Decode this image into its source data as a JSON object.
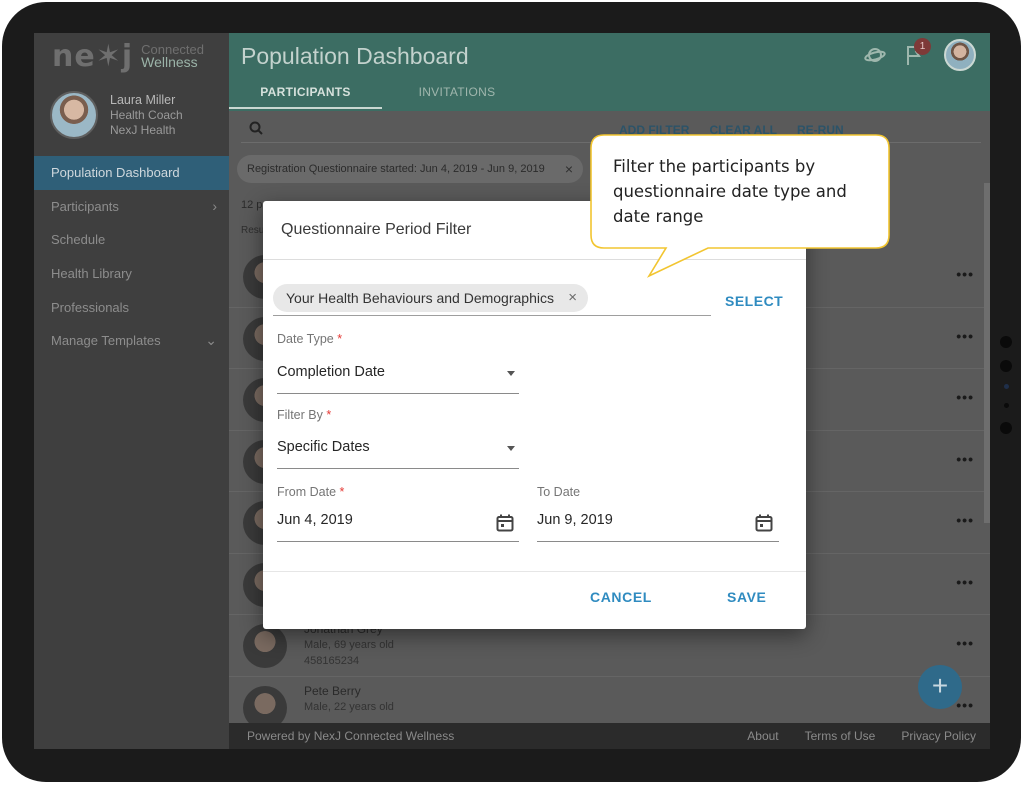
{
  "brand": {
    "mark": "ne✶j",
    "line1": "Connected",
    "line2": "Wellness"
  },
  "user": {
    "name": "Laura Miller",
    "role": "Health Coach",
    "org": "NexJ Health"
  },
  "sidebar": {
    "items": [
      {
        "label": "Population Dashboard",
        "active": true
      },
      {
        "label": "Participants",
        "chevron": "›"
      },
      {
        "label": "Schedule"
      },
      {
        "label": "Health Library"
      },
      {
        "label": "Professionals"
      },
      {
        "label": "Manage Templates",
        "chevron": "⌄"
      }
    ]
  },
  "header": {
    "title": "Population Dashboard",
    "tabs": [
      "PARTICIPANTS",
      "INVITATIONS"
    ],
    "notification_count": "1",
    "icons": [
      "saturn-icon",
      "flag-icon",
      "profile-avatar"
    ]
  },
  "content": {
    "actions": [
      "ADD FILTER",
      "CLEAR ALL",
      "RE-RUN"
    ],
    "filter_chip": "Registration Questionnaire started: Jun 4, 2019 -  Jun 9, 2019",
    "count": "12 p",
    "results_label": "Resu",
    "participants": [
      {
        "name": "",
        "detail": "",
        "id": ""
      },
      {
        "name": "",
        "detail": "",
        "id": ""
      },
      {
        "name": "",
        "detail": "",
        "id": ""
      },
      {
        "name": "",
        "detail": "",
        "id": ""
      },
      {
        "name": "",
        "detail": "",
        "id": ""
      },
      {
        "name": "",
        "detail": "",
        "id": ""
      },
      {
        "name": "Jonathan Grey",
        "detail": "Male, 69 years old",
        "id": "458165234"
      },
      {
        "name": "Pete Berry",
        "detail": "Male, 22 years old",
        "id": ""
      }
    ],
    "more_glyph": "•••"
  },
  "footer": {
    "powered_by": "Powered by NexJ Connected Wellness",
    "links": [
      "About",
      "Terms of Use",
      "Privacy Policy"
    ]
  },
  "fab": {
    "glyph": "+"
  },
  "dialog": {
    "title": "Questionnaire Period Filter",
    "questionnaire": "Your Health Behaviours and Demographics",
    "select_label": "SELECT",
    "date_type": {
      "label": "Date Type",
      "value": "Completion Date"
    },
    "filter_by": {
      "label": "Filter By",
      "value": "Specific Dates"
    },
    "from_date": {
      "label": "From Date",
      "value": "Jun 4, 2019"
    },
    "to_date": {
      "label": "To Date",
      "value": "Jun 9, 2019"
    },
    "required_mark": "*",
    "cancel_label": "CANCEL",
    "save_label": "SAVE"
  },
  "callout": {
    "text": "Filter the participants by questionnaire date type and date range"
  },
  "colors": {
    "accent": "#2f8bc0",
    "header": "#3c6d63",
    "active_nav": "#2f5f78",
    "callout_border": "#f2c530"
  }
}
